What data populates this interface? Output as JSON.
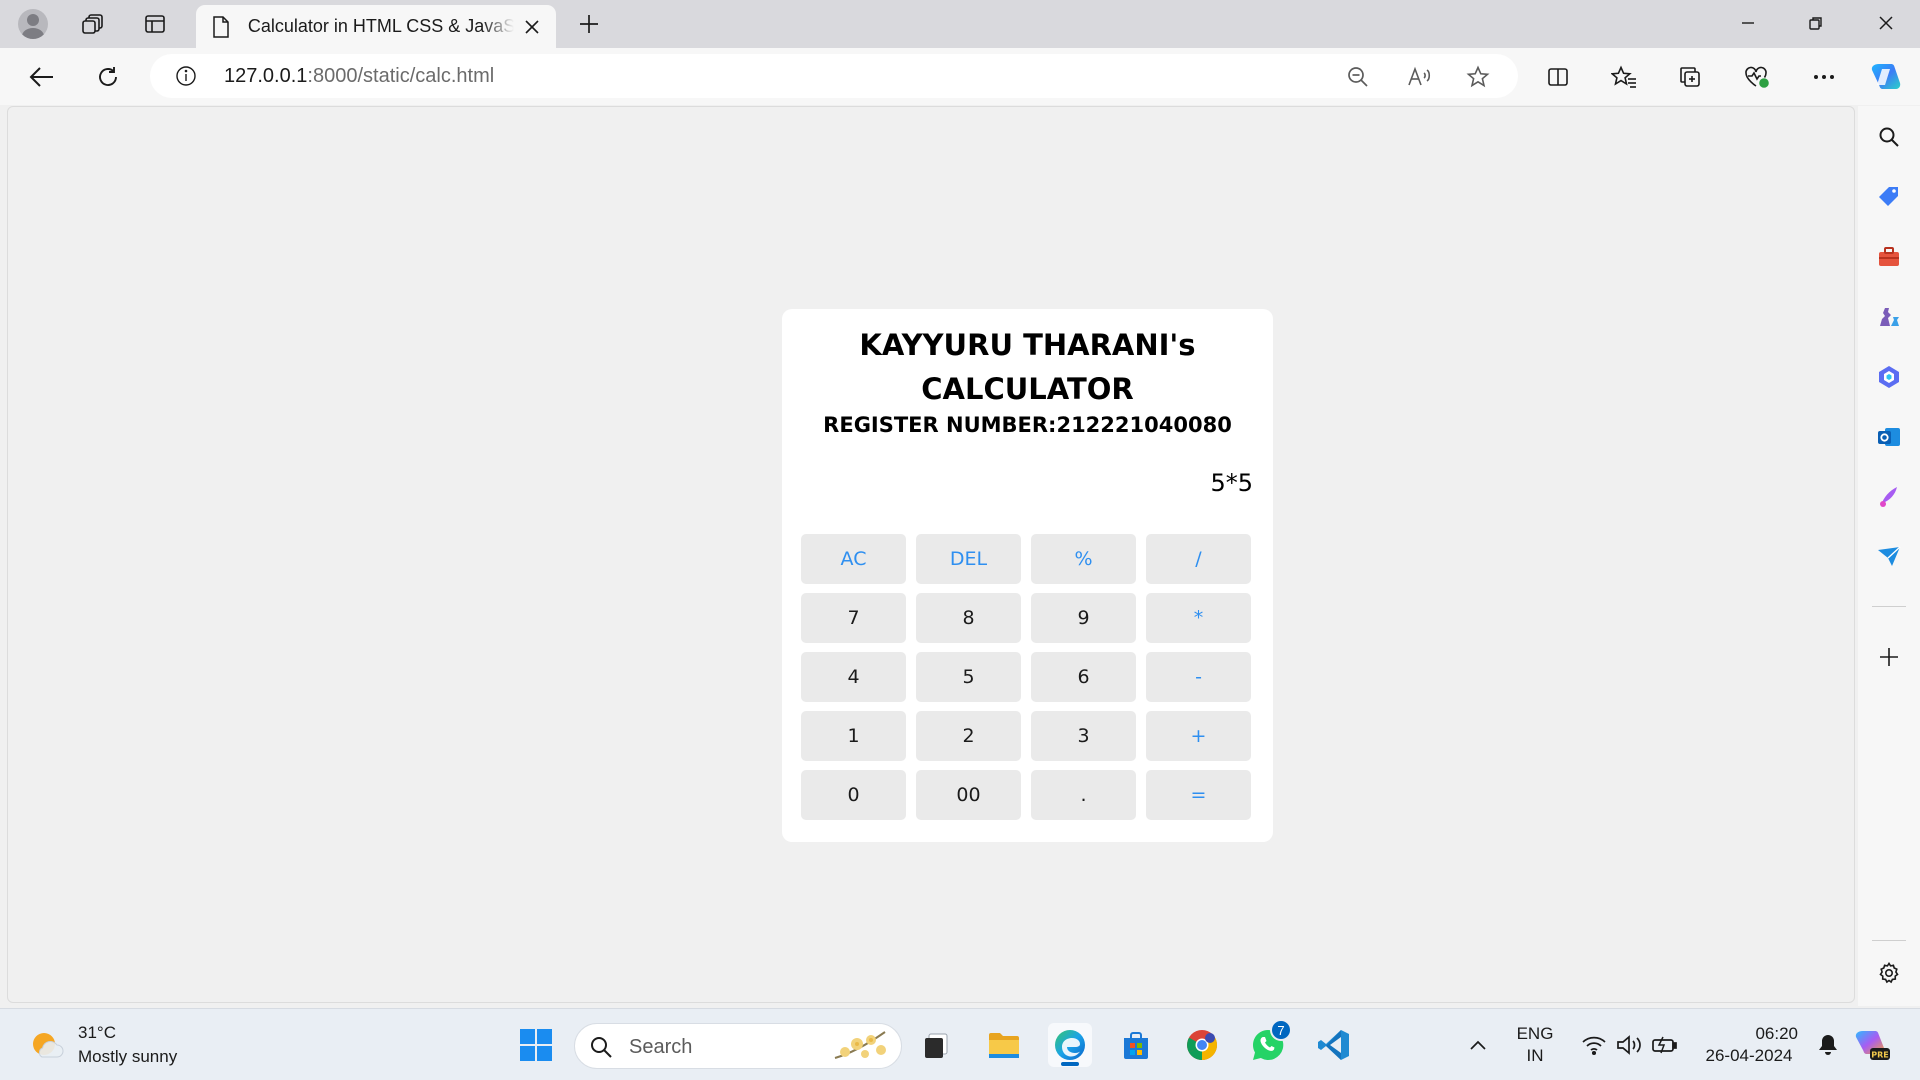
{
  "browser": {
    "tab": {
      "title": "Calculator in HTML CSS & JavaScript"
    },
    "url": {
      "host": "127.0.0.1",
      "rest": ":8000/static/calc.html"
    }
  },
  "calculator": {
    "title_line1": "KAYYURU THARANI's",
    "title_line2": "CALCULATOR",
    "register": "REGISTER NUMBER:212221040080",
    "display": "5*5",
    "keys": [
      "AC",
      "DEL",
      "%",
      "/",
      "7",
      "8",
      "9",
      "*",
      "4",
      "5",
      "6",
      "-",
      "1",
      "2",
      "3",
      "+",
      "0",
      "00",
      ".",
      "="
    ]
  },
  "taskbar": {
    "weather": {
      "temp": "31°C",
      "desc": "Mostly sunny"
    },
    "search": {
      "placeholder": "Search"
    },
    "whatsapp_badge": "7",
    "lang": {
      "line1": "ENG",
      "line2": "IN"
    },
    "clock": {
      "time": "06:20",
      "date": "26-04-2024"
    }
  },
  "colors": {
    "accent": "#2e8ff0",
    "key_bg": "#eaeaea",
    "taskbar_accent": "#0067c0"
  }
}
